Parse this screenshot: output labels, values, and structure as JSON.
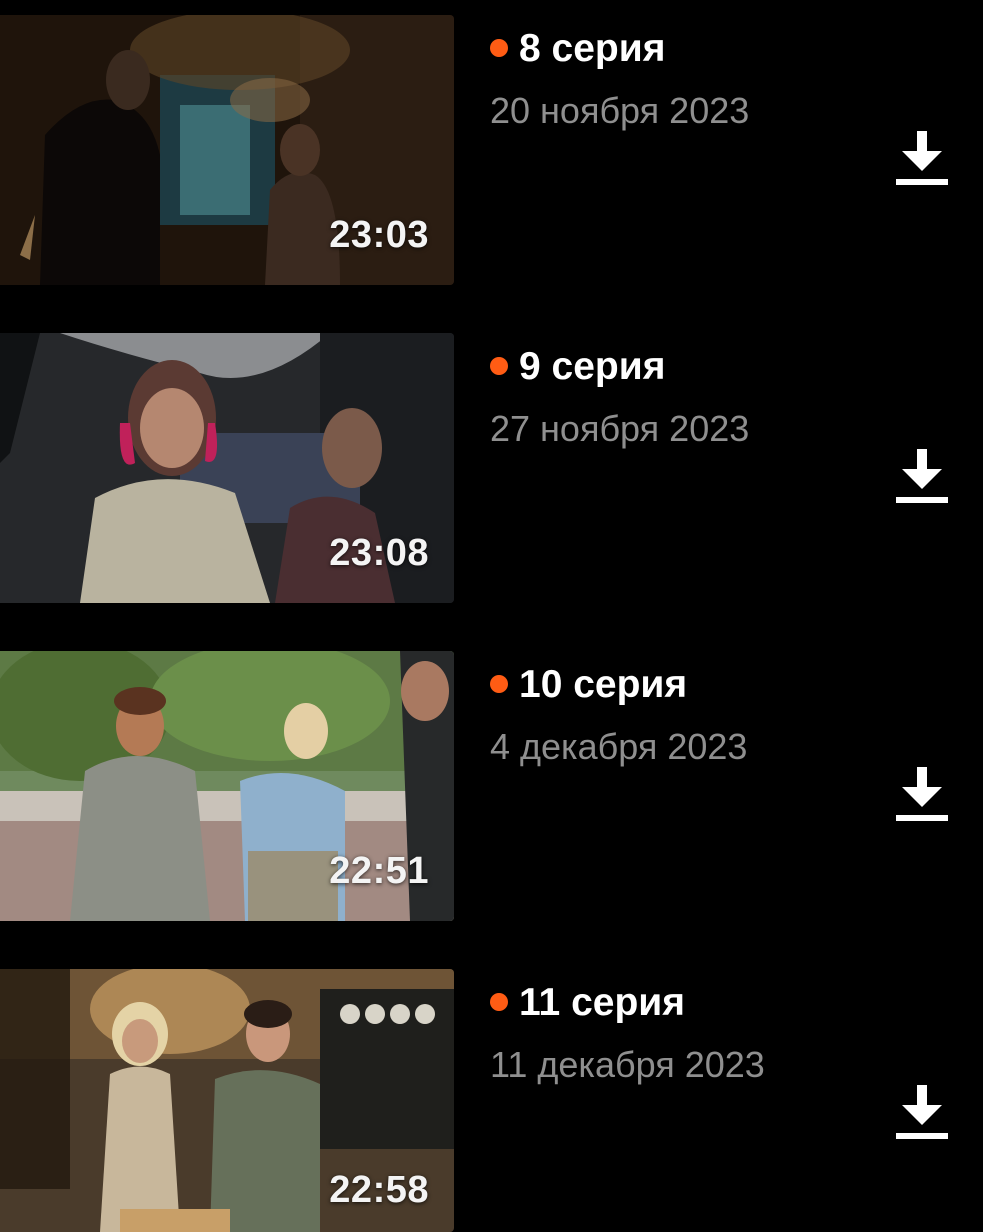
{
  "colors": {
    "background": "#000000",
    "new_dot": "#ff5c14",
    "title": "#ffffff",
    "date": "#8f8f8f"
  },
  "episodes": [
    {
      "title": "8 серия",
      "date": "20 ноября 2023",
      "duration": "23:03",
      "icon": "download-icon"
    },
    {
      "title": "9 серия",
      "date": "27 ноября 2023",
      "duration": "23:08",
      "icon": "download-icon"
    },
    {
      "title": "10 серия",
      "date": "4 декабря 2023",
      "duration": "22:51",
      "icon": "download-icon"
    },
    {
      "title": "11 серия",
      "date": "11 декабря 2023",
      "duration": "22:58",
      "icon": "download-icon"
    }
  ]
}
